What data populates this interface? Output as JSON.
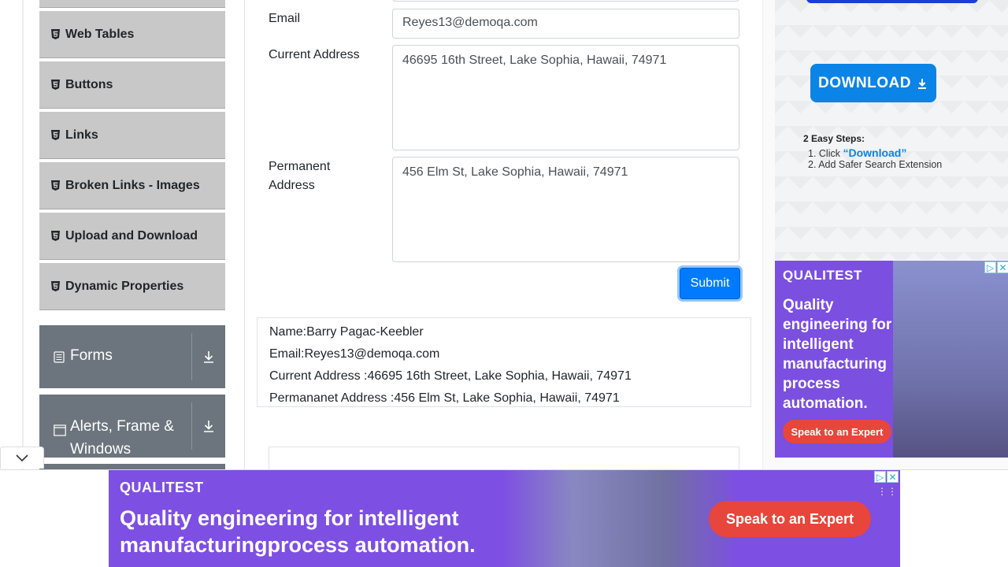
{
  "sidebar": {
    "elements_items": [
      {
        "label": "Web Tables"
      },
      {
        "label": "Buttons"
      },
      {
        "label": "Links"
      },
      {
        "label": "Broken Links - Images"
      },
      {
        "label": "Upload and Download"
      },
      {
        "label": "Dynamic Properties"
      }
    ],
    "groups": [
      {
        "label": "Forms"
      },
      {
        "label": "Alerts, Frame & Windows"
      }
    ]
  },
  "form": {
    "email_label": "Email",
    "email_value": "Reyes13@demoqa.com",
    "current_address_label": "Current Address",
    "current_address_value": "46695 16th Street, Lake Sophia, Hawaii, 74971",
    "permanent_address_label": "Permanent Address",
    "permanent_address_value": "456 Elm St, Lake Sophia, Hawaii, 74971",
    "submit_label": "Submit"
  },
  "output": {
    "name": "Name:Barry Pagac-Keebler",
    "email": "Email:Reyes13@demoqa.com",
    "current_address": "Current Address :46695 16th Street, Lake Sophia, Hawaii, 74971",
    "permanent_address": "Permananet Address :456 Elm St, Lake Sophia, Hawaii, 74971"
  },
  "ads": {
    "download_button": "DOWNLOAD",
    "steps_title": "2 Easy Steps:",
    "step1_prefix": "1. Click",
    "step1_link": "“Download”",
    "step2": "2. Add Safer Search Extension",
    "side_brand": "QUALITEST",
    "side_text": "Quality engineering for intelligent manufacturing process automation.",
    "side_cta": "Speak to an Expert",
    "bottom_brand": "QUALITEST",
    "bottom_text_line1": "Quality engineering for intelligent",
    "bottom_text_line2": "manufacturingprocess automation.",
    "bottom_cta": "Speak to an Expert"
  },
  "colors": {
    "primary": "#007bff",
    "sidebar_item_bg": "#c8c8c8",
    "group_bg": "#6c757d",
    "ad_purple": "#7b4fe0",
    "cta_red": "#e8453c"
  }
}
